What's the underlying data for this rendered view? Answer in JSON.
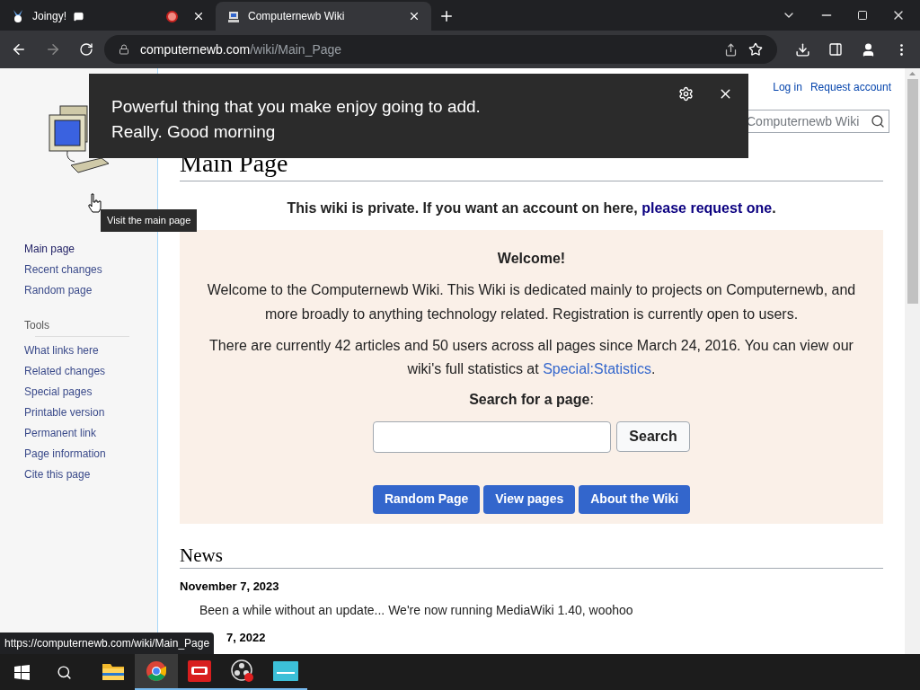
{
  "browser": {
    "tabs": [
      {
        "title": "Joingy!",
        "selected": false,
        "recording": true
      },
      {
        "title": "Computernewb Wiki",
        "selected": true,
        "recording": false
      }
    ],
    "url": {
      "domain": "computernewb.com",
      "path": "/wiki/Main_Page"
    }
  },
  "notification": {
    "lines": [
      "Powerful thing that you make enjoy going to add.",
      "Really. Good morning"
    ]
  },
  "tooltip": "Visit the main page",
  "personal_links": [
    "Log in",
    "Request account"
  ],
  "wiki_search": {
    "placeholder": "Computernewb Wiki"
  },
  "sidebar": {
    "navigation": [
      "Main page",
      "Recent changes",
      "Random page"
    ],
    "tools": {
      "heading": "Tools",
      "items": [
        "What links here",
        "Related changes",
        "Special pages",
        "Printable version",
        "Permanent link",
        "Page information",
        "Cite this page"
      ]
    }
  },
  "page": {
    "title": "Main Page",
    "notice": {
      "text": "This wiki is private. If you want an account on here,",
      "link": "please request one",
      "after": "."
    },
    "welcome": {
      "heading": "Welcome!",
      "intro": "Welcome to the Computernewb Wiki. This Wiki is dedicated mainly to projects on Computernewb, and more broadly to anything technology related. Registration is currently open to users.",
      "stats": {
        "text": "There are currently 42 articles and 50 users across all pages since March 24, 2016. You can view our wiki's full statistics at",
        "link": "Special:Statistics",
        "after": "."
      },
      "search_label": "**Search for a page**:",
      "search_button": "Search",
      "buttons": [
        "Random Page",
        "View pages",
        "About the Wiki"
      ]
    },
    "news": {
      "heading": "News",
      "items": [
        {
          "date": "November 7, 2023",
          "text": "Been a while without an update... We're now running MediaWiki 1.40, woohoo"
        },
        {
          "date": "7, 2022"
        }
      ]
    }
  },
  "status_url": "https://computernewb.com/wiki/Main_Page",
  "taskbar": [
    {
      "kind": "folder",
      "running": false,
      "selected": false
    },
    {
      "kind": "chrome",
      "running": true,
      "selected": true
    },
    {
      "kind": "ovr",
      "running": true,
      "selected": false
    },
    {
      "kind": "obs",
      "running": true,
      "selected": false
    },
    {
      "kind": "screen",
      "running": true,
      "selected": false
    }
  ]
}
